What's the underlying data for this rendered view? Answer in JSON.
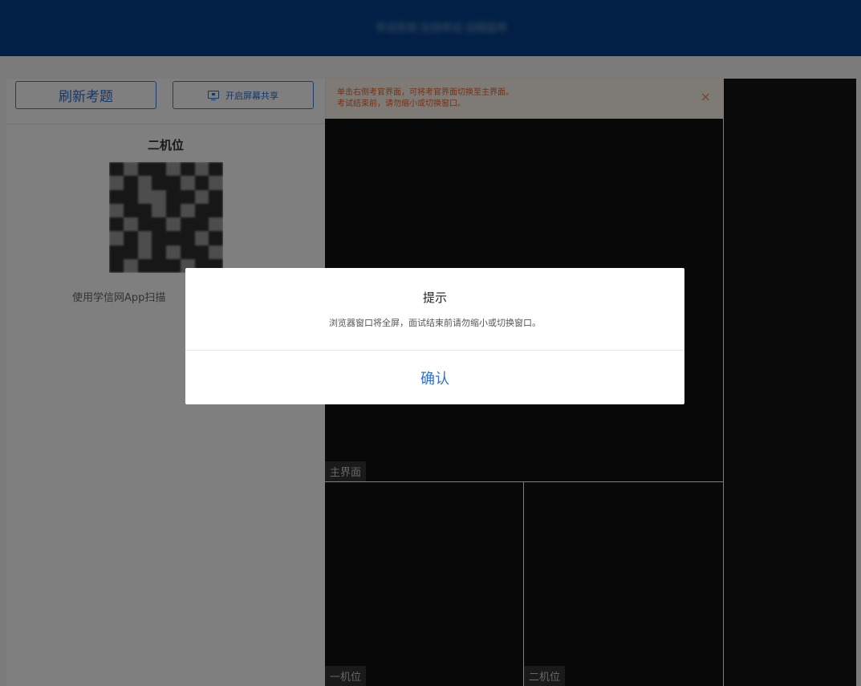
{
  "header": {
    "title": "考试系统 在线考试 远程监考"
  },
  "toolbar": {
    "refresh_label": "刷新考题",
    "share_label": "开启屏幕共享",
    "share_icon": "monitor-icon"
  },
  "left_panel": {
    "camera_title": "二机位",
    "scan_hint": "使用学信网App扫描"
  },
  "notice": {
    "line1": "单击右侧考官界面，可将考官界面切换至主界面。",
    "line2": "考试结束前，请勿缩小或切换窗口。",
    "close": "×"
  },
  "screens": {
    "main_label": "主界面",
    "cam1_label": "一机位",
    "cam2_label": "二机位"
  },
  "dialog": {
    "title": "提示",
    "message": "浏览器窗口将全屏，面试结束前请勿缩小或切换窗口。",
    "confirm": "确认"
  },
  "colors": {
    "header": "#04418d",
    "accent": "#2f6fd0",
    "notice_text": "#e6642e",
    "video_bg": "#111111"
  }
}
